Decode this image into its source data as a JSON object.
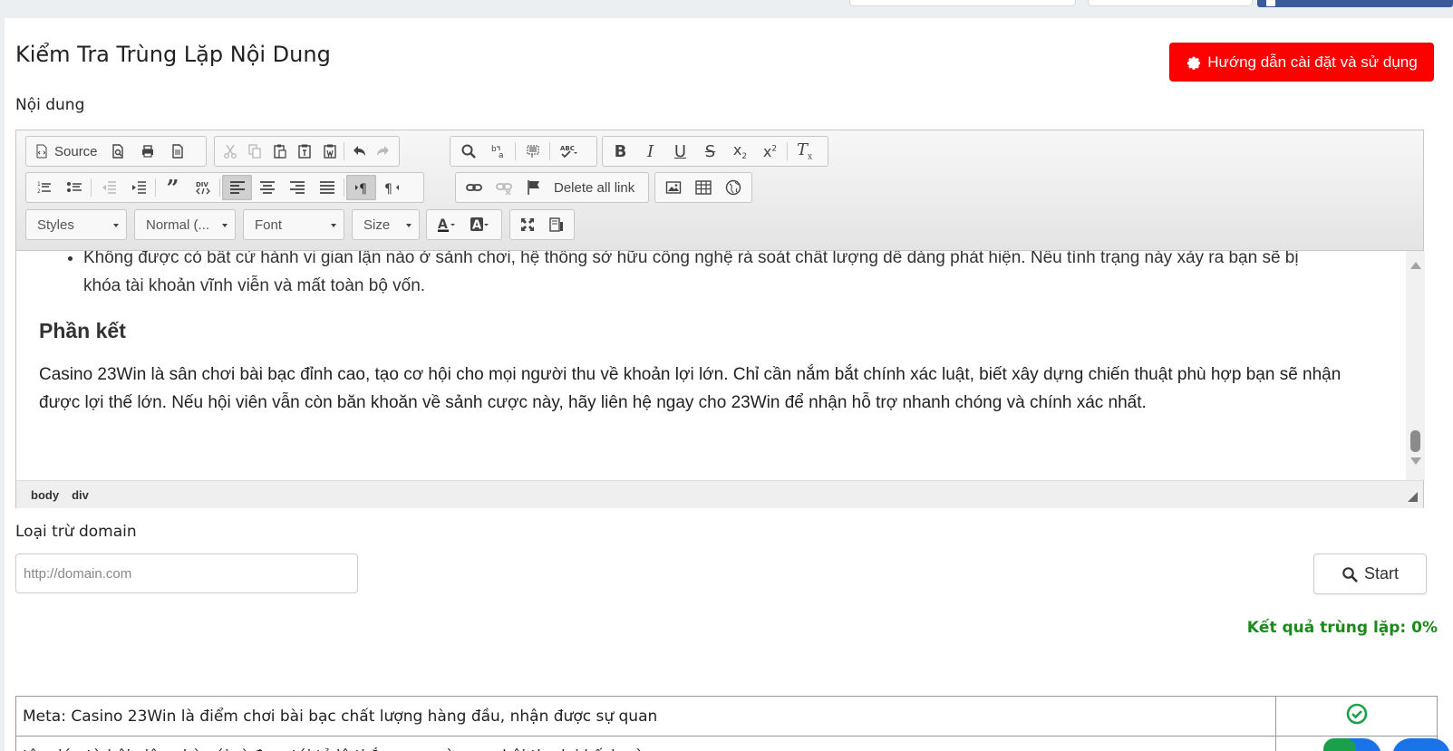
{
  "page": {
    "title": "Kiểm Tra Trùng Lặp Nội Dung",
    "guide_button": "Hướng dẫn cài đặt và sử dụng",
    "content_label": "Nội dung",
    "exclude_label": "Loại trừ domain",
    "domain_placeholder": "http://domain.com",
    "start_button": "Start",
    "result_text": "Kết quả trùng lặp: 0%"
  },
  "toolbar": {
    "source_label": "Source",
    "delete_links_label": "Delete all link",
    "styles_combo": "Styles",
    "format_combo": "Normal (...",
    "font_combo": "Font",
    "size_combo": "Size",
    "abc_label": "ABC",
    "div_label": "DIV"
  },
  "editor": {
    "list_item": "Không được có bất cứ hành vi gian lận nào ở sảnh chơi, hệ thống sở hữu công nghệ rà soát chất lượng dễ dàng phát hiện. Nếu tình trạng này xảy ra bạn sẽ bị khóa tài khoản vĩnh viễn và mất toàn bộ vốn.",
    "heading": "Phần kết",
    "paragraph": "Casino 23Win là sân chơi bài bạc đỉnh cao, tạo cơ hội cho mọi người thu về khoản lợi lớn. Chỉ cần nắm bắt chính xác luật, biết xây dựng chiến thuật phù hợp bạn sẽ nhận được lợi thế lớn. Nếu hội viên vẫn còn băn khoăn về sảnh cược này, hãy liên hệ ngay cho 23Win để nhận hỗ trợ nhanh chóng và chính xác nhất.",
    "path_body": "body",
    "path_div": "div"
  },
  "results": {
    "rows": [
      {
        "text": "Meta: Casino 23Win là điểm chơi bài bạc chất lượng hàng đầu, nhận được sự quan",
        "status": "ok"
      },
      {
        "text": "tâm lớn từ hội viên nhà cái vì đem tới tỷ lệ thắng cao cùng cơ hội thu lợi kếch xù.",
        "status": "ok"
      }
    ]
  },
  "colors": {
    "guide_button_bg": "#ff0000",
    "result_green": "#1a8a1a",
    "ok_icon_green": "#1aa04a",
    "fab_blue": "#1a73e8"
  }
}
